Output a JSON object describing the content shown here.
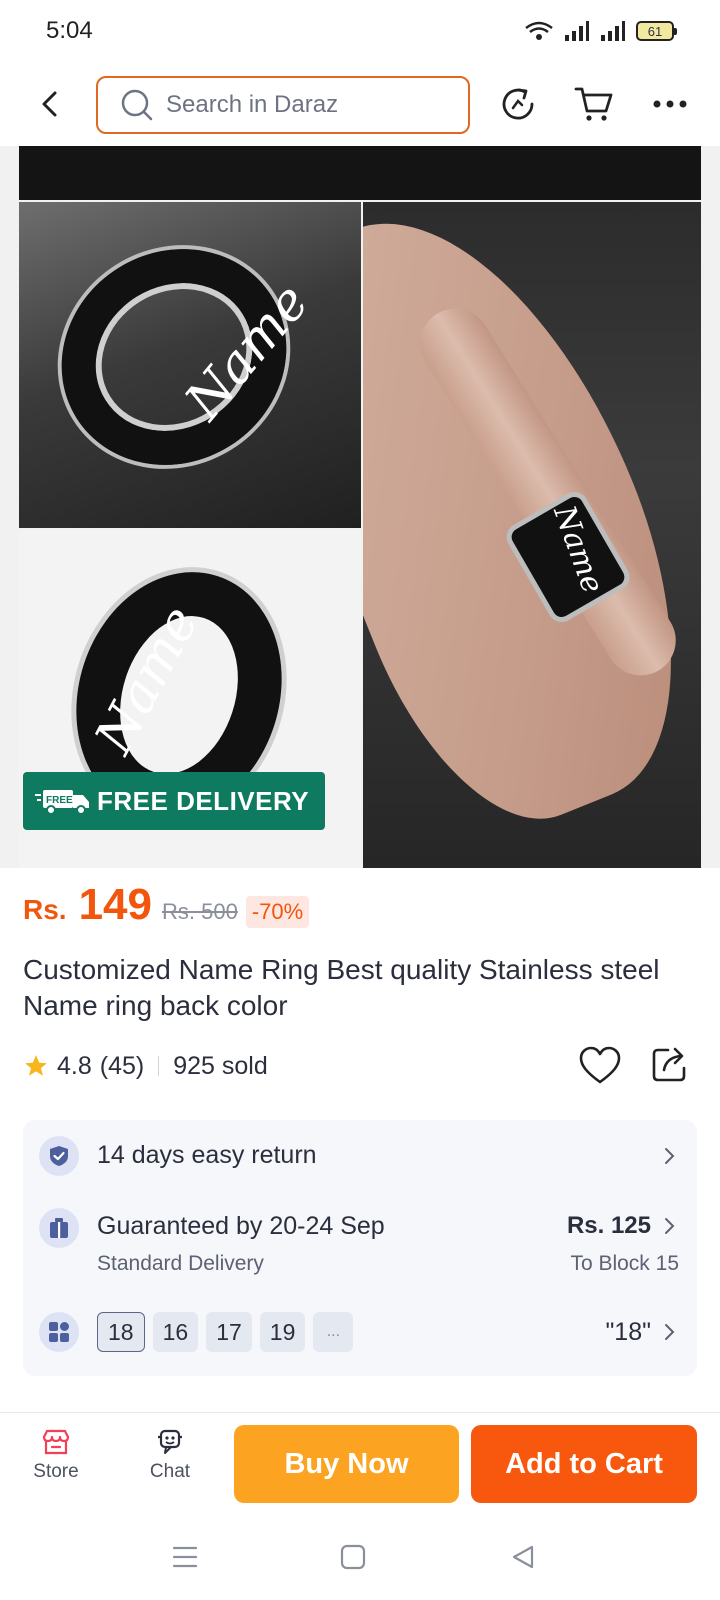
{
  "status_bar": {
    "time": "5:04",
    "battery": "61"
  },
  "search": {
    "placeholder": "Search in Daraz"
  },
  "product_image": {
    "overlay_text": [
      "Name",
      "Name",
      "Name"
    ],
    "badge": "FREE DELIVERY",
    "badge_icon_text": "FREE",
    "badge_color": "#0e7a5f"
  },
  "price": {
    "currency": "Rs.",
    "current": "149",
    "original": "Rs. 500",
    "discount": "-70%",
    "accent": "#f2560d"
  },
  "product": {
    "title": "Customized Name Ring Best quality Stainless steel Name ring back color",
    "rating": "4.8",
    "rating_count": "(45)",
    "sold": "925 sold"
  },
  "service": {
    "return_text": "14 days easy return",
    "delivery_guarantee": "Guaranteed by 20-24 Sep",
    "delivery_type": "Standard Delivery",
    "delivery_price": "Rs. 125",
    "delivery_location": "To Block 15",
    "sizes": [
      "18",
      "16",
      "17",
      "19",
      "..."
    ],
    "selected_size": "\"18\""
  },
  "bottom_bar": {
    "store_label": "Store",
    "chat_label": "Chat",
    "buy_now": "Buy Now",
    "add_to_cart": "Add to Cart",
    "buy_now_color": "#fca421",
    "add_to_cart_color": "#f8580d"
  },
  "icons": {
    "back": "chevron-left-icon",
    "search": "search-icon",
    "refresh": "refresh-icon",
    "cart": "cart-icon",
    "more": "more-dots-icon",
    "heart": "heart-icon",
    "share": "share-icon",
    "return": "shield-check-icon",
    "delivery": "gift-box-icon",
    "variants": "grid-icon",
    "store": "store-icon",
    "chat": "chat-icon"
  }
}
